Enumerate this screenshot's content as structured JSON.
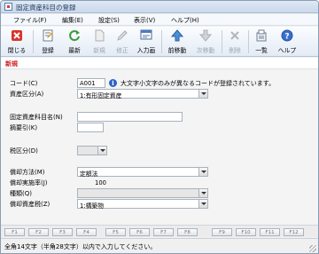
{
  "window": {
    "title": "固定資産科目の登録"
  },
  "menu": [
    "ファイル(F)",
    "編集(E)",
    "設定(S)",
    "表示(V)",
    "ヘルプ(H)"
  ],
  "toolbar": {
    "close": "閉じる",
    "register": "登録",
    "refresh": "最新",
    "new": "新規",
    "modify": "修正",
    "input_screen": "入力画",
    "prev_move": "前移動",
    "next_move": "次移動",
    "delete": "削除",
    "list": "一覧",
    "help": "ヘルプ"
  },
  "mode": "新規",
  "form": {
    "code_label": "コード(C)",
    "code_value": "A001",
    "code_warning": "大文字小文字のみが異なるコードが登録されています。",
    "asset_class_label": "資産区分(A)",
    "asset_class_value": "1:有形固定資産",
    "name_label": "固定資産科目名(N)",
    "name_value": "",
    "summary_label": "摘要引(K)",
    "summary_value": "",
    "tax_class_label": "税区分(D)",
    "tax_class_value": "",
    "method_label": "償却方法(M)",
    "method_value": "定額法",
    "rate_label": "償却実施率(J)",
    "rate_value": "100",
    "type_label": "種類(Q)",
    "type_value": "",
    "depr_asset_tax_label": "償却資産税(Z)",
    "depr_asset_tax_value": "1:構築物"
  },
  "fkeys": [
    "F1",
    "F2",
    "F3",
    "F4",
    "F5",
    "F6",
    "F7",
    "F8",
    "F9",
    "F10",
    "F11",
    "F12"
  ],
  "status": "全角14文字（半角28文字）以内で入力してください。",
  "colors": {
    "mode_red": "#d02020",
    "info_blue": "#2b63c6",
    "title_text": "#1e395b"
  }
}
